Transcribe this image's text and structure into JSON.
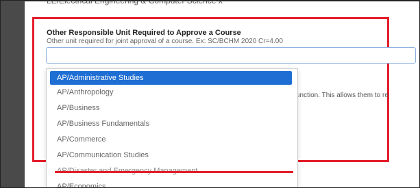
{
  "clipped_text": "LE/Electrical Engineering & Computer Science x",
  "field": {
    "label": "Other Responsible Unit Required to Approve a Course",
    "help": "Other unit required for joint approval of a course. Ex: SC/BCHM 2020 Cr=4.00",
    "value": ""
  },
  "obscured_help_text": "unction. This allows them to re",
  "dropdown": {
    "selected": "AP/Administrative Studies",
    "options": [
      "AP/Anthropology",
      "AP/Business",
      "AP/Business Fundamentals",
      "AP/Commerce",
      "AP/Communication Studies",
      "AP/Disaster and Emergency Management",
      "AP/Economics"
    ]
  },
  "colors": {
    "highlight": "#e41e2b",
    "selection": "#1f6ed4"
  }
}
